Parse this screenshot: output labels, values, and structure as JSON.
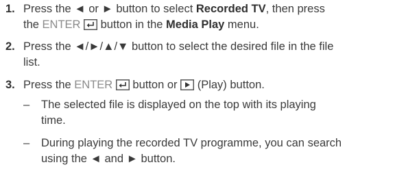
{
  "steps": [
    {
      "number": "1.",
      "lines": [
        {
          "pre": "Press the ◄ or ► button to select ",
          "bold": "Recorded TV",
          "post": ", then press"
        },
        {
          "pre": "the ",
          "enter": "ENTER",
          "mid": " button in the ",
          "bold": "Media Play",
          "post": " menu."
        }
      ]
    },
    {
      "number": "2.",
      "lines": [
        {
          "text": "Press the ◄/►/▲/▼ button to select the desired file in the file"
        },
        {
          "text": "list."
        }
      ]
    },
    {
      "number": "3.",
      "line": {
        "pre": "Press the ",
        "enter": "ENTER",
        "mid": " button or ",
        "post": " (Play) button."
      },
      "bullets": [
        {
          "dash": "–",
          "lines": [
            "The selected file is displayed on the top with its playing",
            "time."
          ]
        },
        {
          "dash": "–",
          "lines": [
            "During playing the recorded TV programme, you can search",
            "using the ◄ and ► button."
          ]
        }
      ]
    }
  ],
  "icons": {
    "enter": "enter-key-icon",
    "play": "play-button-icon"
  }
}
